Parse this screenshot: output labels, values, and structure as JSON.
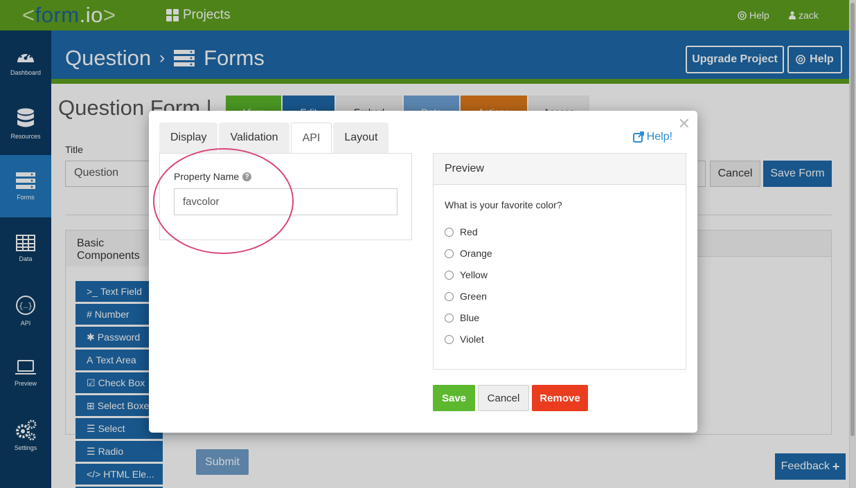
{
  "topbar": {
    "logo_lt": "<",
    "logo_form": "form",
    "logo_io": ".io",
    "logo_gt": ">",
    "projects_label": "Projects",
    "help_label": "Help",
    "user_label": "zack",
    "background_color": "#5fa01e"
  },
  "sidebar": {
    "items": [
      {
        "label": "Dashboard",
        "icon": "dashboard-icon"
      },
      {
        "label": "Resources",
        "icon": "database-icon"
      },
      {
        "label": "Forms",
        "icon": "forms-icon",
        "active": true
      },
      {
        "label": "Data",
        "icon": "table-icon"
      },
      {
        "label": "API",
        "icon": "api-icon"
      },
      {
        "label": "Preview",
        "icon": "laptop-icon"
      },
      {
        "label": "Settings",
        "icon": "gears-icon"
      }
    ]
  },
  "header": {
    "project": "Question",
    "separator": "›",
    "section": "Forms",
    "upgrade_label": "Upgrade Project",
    "help_label": "Help"
  },
  "form": {
    "title": "Question Form |",
    "tabs": [
      {
        "label": "View",
        "color": "#5bb72b"
      },
      {
        "label": "Edit",
        "color": "#1e6aaa"
      },
      {
        "label": "Embed",
        "color": "#eeeeee"
      },
      {
        "label": "Data",
        "color": "#6fa4d8"
      },
      {
        "label": "Actions",
        "color": "#e07b1c"
      },
      {
        "label": "Access",
        "color": "#eeeeee"
      }
    ],
    "title_label": "Title",
    "title_value": "Question",
    "cancel_label": "Cancel",
    "save_label": "Save Form"
  },
  "components": {
    "heading": "Basic Components",
    "items": [
      {
        "icon": ">_",
        "label": "Text Field"
      },
      {
        "icon": "#",
        "label": "Number"
      },
      {
        "icon": "✱",
        "label": "Password"
      },
      {
        "icon": "A",
        "label": "Text Area"
      },
      {
        "icon": "☑",
        "label": "Check Box"
      },
      {
        "icon": "⊞",
        "label": "Select Boxes"
      },
      {
        "icon": "☰",
        "label": "Select"
      },
      {
        "icon": "☰",
        "label": "Radio"
      },
      {
        "icon": "</>",
        "label": "HTML Ele..."
      }
    ],
    "submit_label": "Submit"
  },
  "feedback_label": "Feedback",
  "modal": {
    "tabs": [
      "Display",
      "Validation",
      "API",
      "Layout"
    ],
    "active_tab": "API",
    "help_label": "Help!",
    "property_label": "Property Name",
    "property_value": "favcolor",
    "preview_heading": "Preview",
    "question": "What is your favorite color?",
    "options": [
      "Red",
      "Orange",
      "Yellow",
      "Green",
      "Blue",
      "Violet"
    ],
    "save_label": "Save",
    "cancel_label": "Cancel",
    "remove_label": "Remove",
    "save_color": "#5cb82e",
    "remove_color": "#ea3c1f"
  }
}
